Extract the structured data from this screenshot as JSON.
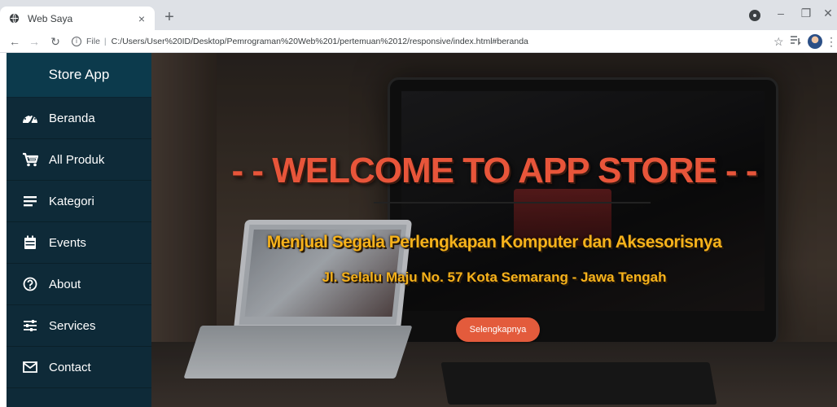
{
  "browser": {
    "tab_title": "Web Saya",
    "tab_close": "×",
    "new_tab": "+",
    "address_scheme": "File",
    "address_sep": "|",
    "address_url": "C:/Users/User%20ID/Desktop/Pemrograman%20Web%201/pertemuan%2012/responsive/index.html#beranda",
    "icons": [
      "globe-icon",
      "back-icon",
      "forward-icon",
      "reload-icon",
      "info-icon",
      "star-icon",
      "reading-list-icon",
      "profile-icon",
      "menu-icon"
    ]
  },
  "sidebar": {
    "brand": "Store App",
    "items": [
      {
        "label": "Beranda",
        "icon": "dashboard-icon"
      },
      {
        "label": "All Produk",
        "icon": "cart-icon"
      },
      {
        "label": "Kategori",
        "icon": "bars-icon"
      },
      {
        "label": "Events",
        "icon": "calendar-icon"
      },
      {
        "label": "About",
        "icon": "help-circle-icon"
      },
      {
        "label": "Services",
        "icon": "sliders-icon"
      },
      {
        "label": "Contact",
        "icon": "mail-icon"
      }
    ]
  },
  "hero": {
    "title": "- - WELCOME TO APP STORE - -",
    "subtitle": "Menjual Segala Perlengkapan Komputer dan Aksesorisnya",
    "address": "Jl. Selalu Maju No. 57 Kota Semarang - Jawa Tengah",
    "button": "Selengkapnya"
  },
  "colors": {
    "sidebar_bg": "#0e2a38",
    "title_color": "#e8553a",
    "subtitle_color": "#f6b21b",
    "button_color": "#e35b3c"
  }
}
